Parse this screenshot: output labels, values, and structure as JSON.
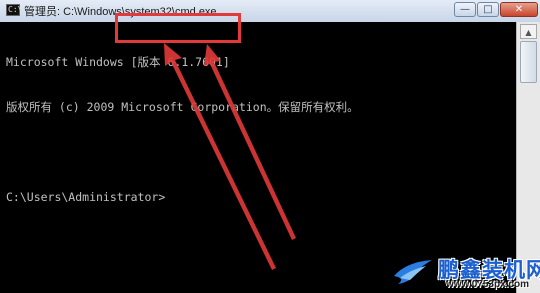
{
  "window": {
    "title": "管理员: C:\\Windows\\system32\\cmd.exe",
    "icon_text": "C:\\",
    "minimize_glyph": "—",
    "maximize_glyph": "□",
    "close_glyph": "✕"
  },
  "console": {
    "lines": [
      "Microsoft Windows [版本 6.1.7601]",
      "版权所有 (c) 2009 Microsoft Corporation。保留所有权利。",
      "",
      "C:\\Users\\Administrator>"
    ]
  },
  "annotation": {
    "color": "#e23a3a"
  },
  "watermark": {
    "name": "鹏鑫装机网",
    "url": "www.0753px.com"
  },
  "colors": {
    "console_bg": "#000000",
    "console_text": "#c0c0c0",
    "accent_red": "#e23a3a",
    "brand_blue": "#1b5fd1"
  }
}
